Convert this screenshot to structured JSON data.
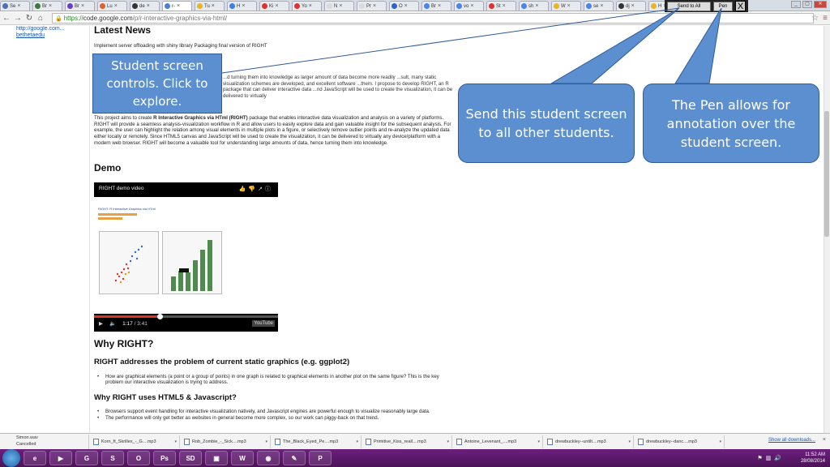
{
  "browser": {
    "tabs": [
      {
        "label": "Se",
        "color": "#4c6fb5"
      },
      {
        "label": "Br",
        "color": "#3d7a3d"
      },
      {
        "label": "Br",
        "color": "#6a3ec2"
      },
      {
        "label": "Lu",
        "color": "#e0602c"
      },
      {
        "label": "de",
        "color": "#333333"
      },
      {
        "label": "r-",
        "color": "#4a80d9"
      },
      {
        "label": "Tu",
        "color": "#e8b420"
      },
      {
        "label": "H",
        "color": "#3c7fe6"
      },
      {
        "label": "Ki",
        "color": "#e03131"
      },
      {
        "label": "Yo",
        "color": "#e03131"
      },
      {
        "label": "N",
        "color": "#d9d9d9"
      },
      {
        "label": "Pr",
        "color": "#d9d9d9"
      },
      {
        "label": "O",
        "color": "#2f62c9"
      },
      {
        "label": "Br",
        "color": "#4a86e8"
      },
      {
        "label": "vo",
        "color": "#4a86e8"
      },
      {
        "label": "St",
        "color": "#e03131"
      },
      {
        "label": "sh",
        "color": "#4a86e8"
      },
      {
        "label": "W",
        "color": "#e8b420"
      },
      {
        "label": "se",
        "color": "#4a86e8"
      },
      {
        "label": "dj",
        "color": "#333333"
      },
      {
        "label": "H",
        "color": "#e8b420"
      },
      {
        "label": "M",
        "color": "#d9d9d9"
      }
    ],
    "active_tab_index": 5,
    "url_scheme": "https://",
    "url_host": "code.google.com",
    "url_path": "/p/r-interactive-graphics-via-html/"
  },
  "student_controls": {
    "send_label": "Send to All",
    "pen_label": "Pen",
    "close_label": "X"
  },
  "sidebar": {
    "link_line1": "http://google.com...",
    "link_line2": "bethetaedu"
  },
  "page": {
    "news_heading": "Latest News",
    "news_text": "Implement server offloading with shiny library Packaging final version of RIGHT",
    "para1": "...d turning them into knowledge as larger amount of data become more readily ...sult, many static visualization schemes are developed, and excellent software ...them. I propose to develop RIGHT, an R package that can deliver interactive data ...nd JavaScript will be used to create the visualization, it can be delivered to virtually",
    "para2_pre": "This project aims to create ",
    "para2_bold": "R Interactive Graphics via HTml (RIGHT)",
    "para2_post": " package that enables interactive data visualization and analysis on a variety of platforms. RIGHT will provide a seamless analysis-visualization workflow in R and allow users to easily explore data and gain valuable insight for the subsequent analysis. For example, the user can highlight the relation among visual elements in multiple plots in a figure, or selectively remove outlier points and re-analyze the updated data either locally or remotely. Since HTML5 canvas and JavaScript will be used to create the visualization, it can be delivered to virtually any device/platform with a modern web browser. RIGHT will become a valuable tool for understanding large amounts of data, hence turning them into knowledge.",
    "demo_heading": "Demo",
    "video_title": "RIGHT demo video",
    "video_frame_title": "RIGHT: R Interactive Graphics via HTml",
    "video_time": "1:17",
    "video_duration": "/ 3:41",
    "video_logo": "YouTube",
    "why_heading": "Why RIGHT?",
    "addr_heading": "RIGHT addresses the problem of current static graphics (e.g. ggplot2)",
    "bullets1": [
      "How are graphical elements (a point or a group of points) in one graph is related to graphical elements in another plot on the same figure? This is the key problem our interactive visualization is trying to address."
    ],
    "html5_heading": "Why RIGHT uses HTML5 & Javascript?",
    "bullets2": [
      "Browsers support event handling for interactive visualization natively, and Javascript engines are powerful enough to visualize reasonably large data.",
      "The performance will only get better as websites in general become more complex, so our work can piggy-back on that trend."
    ]
  },
  "callouts": {
    "c1": "Student screen controls. Click to explore.",
    "c2": "Send this student screen to all other students.",
    "c3": "The Pen allows for annotation over the student screen.",
    "color": "#5b8fd0"
  },
  "downloads": {
    "first_name": "Simon.wav",
    "first_status": "Cancelled",
    "items": [
      "Korn_ft_Skrillex_-_G....mp3",
      "Rob_Zombie_-_Sick....mp3",
      "The_Black_Eyed_Pe....mp3",
      "Primitive_Kiss_reall....mp3",
      "Antoine_Levenant_....mp3",
      "drewbuckley--untilt....mp3",
      "drewbuckley--danc....mp3"
    ],
    "show_all": "Show all downloads...",
    "close": "×"
  },
  "taskbar": {
    "apps": [
      "e",
      "▶",
      "G",
      "S",
      "O",
      "Ps",
      "SD",
      "▣",
      "W",
      "◉",
      "✎",
      "P"
    ],
    "time": "11:52 AM",
    "date": "28/08/2014"
  }
}
